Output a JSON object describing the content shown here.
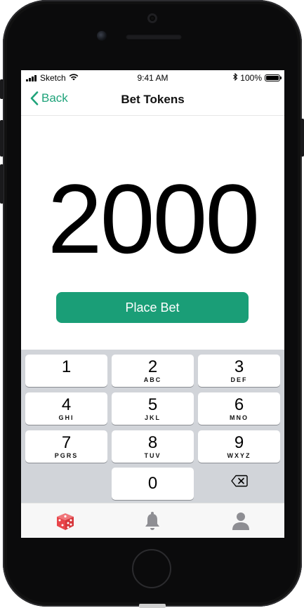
{
  "status_bar": {
    "carrier": "Sketch",
    "time": "9:41 AM",
    "battery": "100%"
  },
  "nav": {
    "back_label": "Back",
    "title": "Bet Tokens"
  },
  "amount": "2000",
  "place_bet_label": "Place Bet",
  "keypad": {
    "keys": [
      {
        "digit": "1",
        "letters": ""
      },
      {
        "digit": "2",
        "letters": "ABC"
      },
      {
        "digit": "3",
        "letters": "DEF"
      },
      {
        "digit": "4",
        "letters": "GHI"
      },
      {
        "digit": "5",
        "letters": "JKL"
      },
      {
        "digit": "6",
        "letters": "MNO"
      },
      {
        "digit": "7",
        "letters": "PGRS"
      },
      {
        "digit": "8",
        "letters": "TUV"
      },
      {
        "digit": "9",
        "letters": "WXYZ"
      },
      {
        "digit": "0",
        "letters": ""
      }
    ]
  },
  "tabs": [
    {
      "icon": "dice-icon",
      "active": true
    },
    {
      "icon": "bell-icon",
      "active": false
    },
    {
      "icon": "person-icon",
      "active": false
    }
  ],
  "colors": {
    "accent": "#1a9e77",
    "back_link": "#1fa37a",
    "dice_active": "#e8454a",
    "tab_inactive": "#8e8e93",
    "keypad_bg": "#d1d4d9"
  }
}
